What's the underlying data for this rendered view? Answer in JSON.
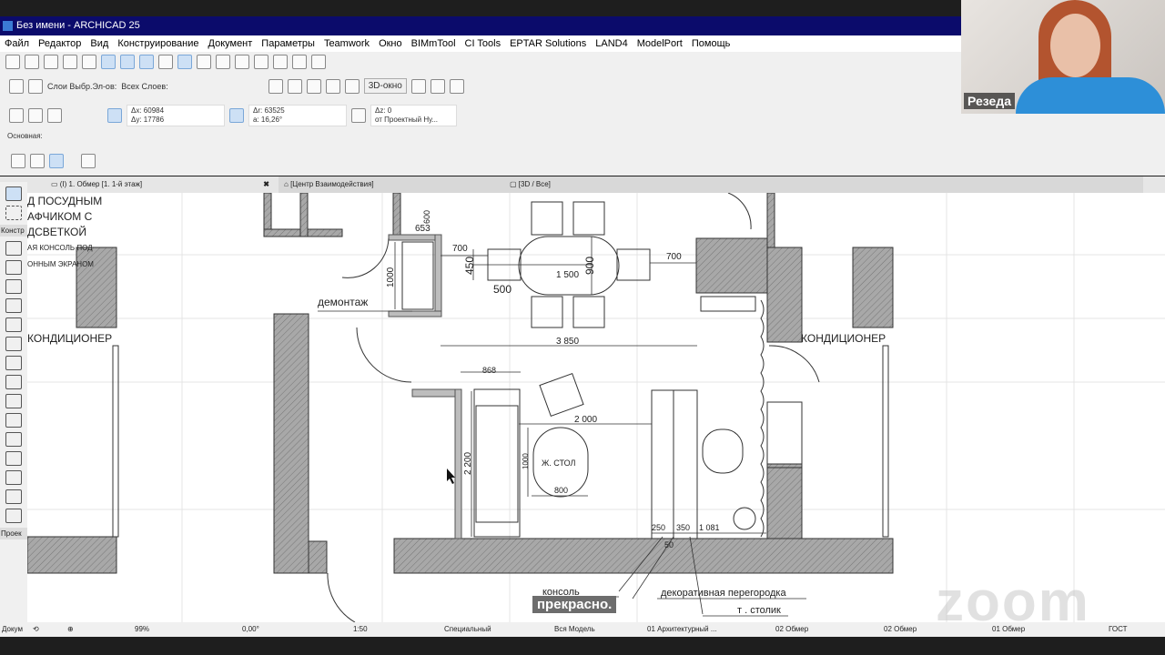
{
  "window": {
    "title": "Без имени - ARCHICAD 25"
  },
  "menu": [
    "Файл",
    "Редактор",
    "Вид",
    "Конструирование",
    "Документ",
    "Параметры",
    "Teamwork",
    "Окно",
    "BIMmTool",
    "CI Tools",
    "EPTAR Solutions",
    "LAND4",
    "ModelPort",
    "Помощь"
  ],
  "toolbar": {
    "layers_label": "Слои Выбр.Эл-ов:",
    "all_layers_label": "Всех Слоев:",
    "view3d_label": "3D-окно",
    "dx": "Δx: 60984",
    "dy": "Δy: 17786",
    "dr": "Δr: 63525",
    "angle": "a: 16,26°",
    "dz": "Δz: 0",
    "ref": "от Проектный Ну..."
  },
  "basic_label": "Основная:",
  "tabs": [
    {
      "label": "(I) 1. Обмер [1. 1-й этаж]"
    },
    {
      "label": "[Центр Взаимодействия]"
    },
    {
      "label": "[3D / Все]"
    }
  ],
  "toolbox": {
    "construct_label": "Констр",
    "project_label": "Проек",
    "doc_label": "Докум"
  },
  "drawing": {
    "notes": [
      "Д ПОСУДНЫМ",
      "АФЧИКОМ С",
      "ДСВЕТКОЙ",
      "АЯ КОНСОЛЬ ПОД",
      "ОННЫМ ЭКРАНОМ"
    ],
    "labels": {
      "conditioner_left": "КОНДИЦИОНЕР",
      "conditioner_right": "КОНДИЦИОНЕР",
      "demolition": "демонтаж",
      "coffee_table": "Ж. СТОЛ",
      "console": "консоль",
      "partition": "декоративная перегородка",
      "side_table": "т . столик"
    },
    "dims": {
      "d653": "653",
      "d600": "600",
      "d700a": "700",
      "d700b": "700",
      "d450": "450",
      "d1500": "1 500",
      "d900": "900",
      "d500": "500",
      "d1000a": "1000",
      "d3850": "3 850",
      "d868": "868",
      "d2000": "2 000",
      "d2200": "2 200",
      "d1000b": "1000",
      "d800": "800",
      "d250": "250",
      "d350": "350",
      "d1081": "1 081",
      "d50": "50"
    }
  },
  "status": {
    "doc": "Докум",
    "zoom": "99%",
    "angle": "0,00°",
    "scale": "1:50",
    "layer_combo": "Специальный",
    "model": "Вся Модель",
    "pen": "01 Архитектурный ...",
    "view1": "02 Обмер",
    "view2": "02 Обмер",
    "view3": "01 Обмер",
    "standard": "ГОСТ"
  },
  "webcam": {
    "name": "Резеда"
  },
  "subtitle": "прекрасно.",
  "watermark": "zoom"
}
